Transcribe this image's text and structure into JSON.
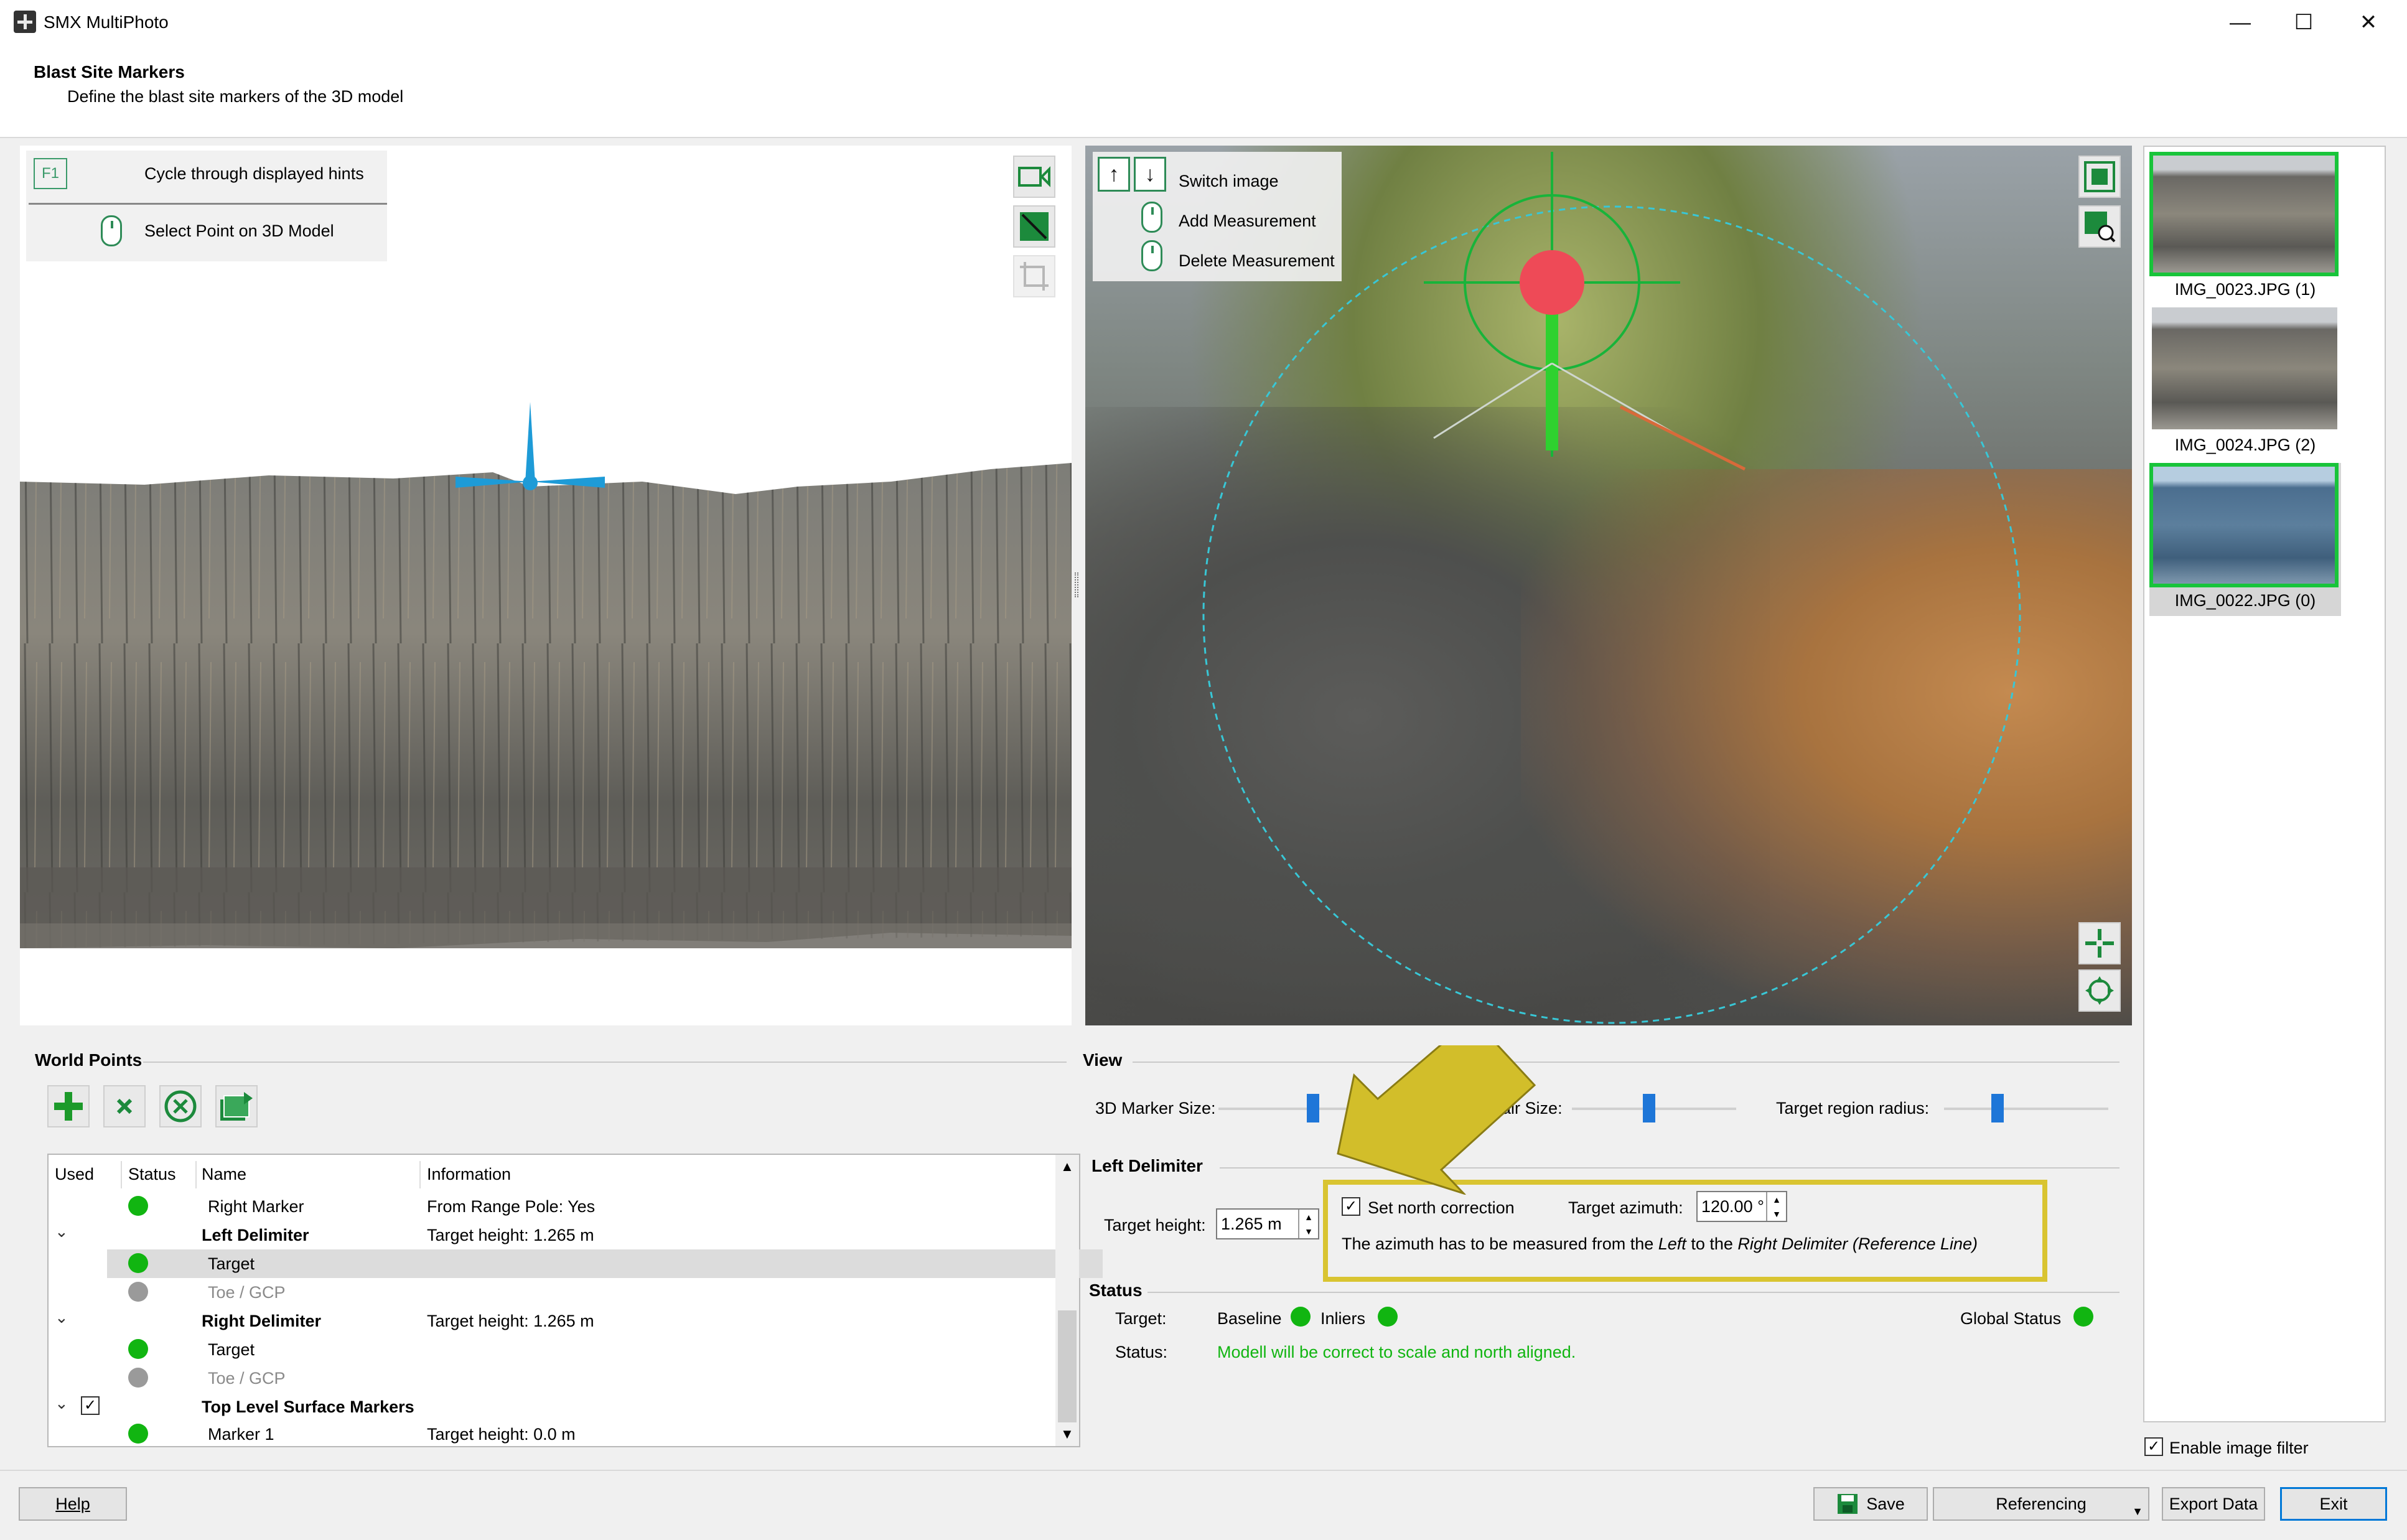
{
  "window": {
    "title": "SMX MultiPhoto",
    "minimize_glyph": "—",
    "maximize_glyph": "☐",
    "close_glyph": "✕"
  },
  "header": {
    "title": "Blast Site Markers",
    "subtitle": "Define the blast site markers of the 3D model"
  },
  "model_hints": {
    "f1_key": "F1",
    "cycle_hints": "Cycle through displayed hints",
    "select_point": "Select Point on 3D Model"
  },
  "photo_hints": {
    "up_glyph": "↑",
    "down_glyph": "↓",
    "switch_image": "Switch image",
    "add_measurement": "Add Measurement",
    "delete_measurement": "Delete Measurement"
  },
  "thumbnails": [
    {
      "label": "IMG_0023.JPG (1)",
      "selected": true
    },
    {
      "label": "IMG_0024.JPG (2)",
      "selected": false
    },
    {
      "label": "IMG_0022.JPG (0)",
      "selected": true
    }
  ],
  "world_points": {
    "title": "World Points",
    "toolbar_icons": [
      "add-icon",
      "delete-icon",
      "remove-circle-icon",
      "import-icon"
    ],
    "columns": [
      "Used",
      "Status",
      "Name",
      "Information"
    ],
    "rows": [
      {
        "name": "Right Marker",
        "info": "From Range Pole: Yes",
        "status": "green"
      },
      {
        "name": "Left Delimiter",
        "info": "Target height: 1.265 m",
        "group": true
      },
      {
        "name": "Target",
        "info": "",
        "status": "green",
        "selected": true
      },
      {
        "name": "Toe / GCP",
        "info": "",
        "status": "grey",
        "muted": true
      },
      {
        "name": "Right Delimiter",
        "info": "Target height: 1.265 m",
        "group": true
      },
      {
        "name": "Target",
        "info": "",
        "status": "green"
      },
      {
        "name": "Toe / GCP",
        "info": "",
        "status": "grey",
        "muted": true
      },
      {
        "name": "Top Level Surface Markers",
        "info": "",
        "group": true,
        "checked": true
      },
      {
        "name": "Marker 1",
        "info": "Target height: 0.0 m",
        "status": "green"
      }
    ],
    "checkbox_glyph": "✓",
    "expand_glyph": "⌄",
    "scroll_up": "▲",
    "scroll_down": "▼"
  },
  "view": {
    "title": "View",
    "marker_size_label": "3D Marker Size:",
    "crosshair_label": "osshair Size:",
    "target_radius_label": "Target region radius:"
  },
  "left_delimiter": {
    "title": "Left Delimiter",
    "target_height_label": "Target height:",
    "target_height_value": "1.265 m",
    "north_correction_label": "Set north correction",
    "north_correction_checked": true,
    "azimuth_label": "Target azimuth:",
    "azimuth_value": "120.00 °",
    "note_prefix": "The azimuth has to be measured from the ",
    "note_left": "Left",
    "note_mid": " to the ",
    "note_right": "Right Delimiter (Reference Line)",
    "spin_up": "▲",
    "spin_down": "▼"
  },
  "status": {
    "title": "Status",
    "target_label": "Target:",
    "baseline_label": "Baseline",
    "inliers_label": "Inliers",
    "global_label": "Global Status",
    "status_label": "Status:",
    "message": "Modell will be correct to scale and north aligned.",
    "ok_color": "#11b511"
  },
  "footer": {
    "enable_filter_label": "Enable image filter",
    "enable_filter_checked": true,
    "help": "Help",
    "save": "Save",
    "referencing": "Referencing",
    "export": "Export Data",
    "exit": "Exit"
  },
  "colors": {
    "accent_blue": "#0078d7",
    "highlight_yellow": "#d9c431",
    "marker_cyan": "#1e9bd7",
    "status_green": "#11b511"
  }
}
